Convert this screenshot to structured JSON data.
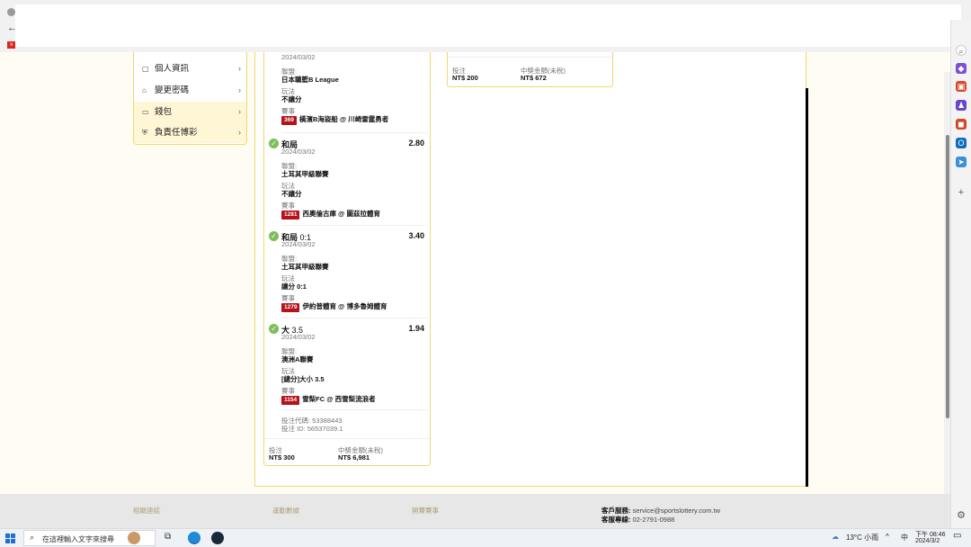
{
  "side_menu": {
    "items": [
      {
        "label": "個人資訊",
        "icon": "user-card-icon"
      },
      {
        "label": "變更密碼",
        "icon": "lock-icon"
      },
      {
        "label": "錢包",
        "icon": "wallet-icon"
      },
      {
        "label": "負責任博彩",
        "icon": "shield-icon"
      }
    ]
  },
  "ticket1": {
    "leg0": {
      "date": "2024/03/02",
      "league_label": "聯盟:",
      "league": "日本職籃B League",
      "bet_label": "玩法",
      "bet": "不讓分",
      "event_label": "賽事",
      "event_no": "369",
      "event": "橫濱B海盜船 @ 川崎雷霆勇者"
    },
    "leg1": {
      "selection": "和局",
      "odds": "2.80",
      "date": "2024/03/02",
      "league_label": "聯盟:",
      "league": "土耳其甲級聯賽",
      "bet_label": "玩法",
      "bet": "不讓分",
      "event_label": "賽事",
      "event_no": "1281",
      "event": "西奧倫古庫 @ 圖茲拉體育"
    },
    "leg2": {
      "selection": "和局",
      "selection_extra": "0:1",
      "odds": "3.40",
      "date": "2024/03/02",
      "league_label": "聯盟:",
      "league": "土耳其甲級聯賽",
      "bet_label": "玩法",
      "bet": "讓分 0:1",
      "event_label": "賽事",
      "event_no": "1279",
      "event": "伊約普體育 @ 博多魯姆體育"
    },
    "leg3": {
      "selection": "大",
      "selection_extra": "3.5",
      "odds": "1.94",
      "date": "2024/03/02",
      "league_label": "聯盟:",
      "league": "澳洲A聯賽",
      "bet_label": "玩法",
      "bet": "[總分]大小 3.5",
      "event_label": "賽事",
      "event_no": "1154",
      "event": "雪梨FC @ 西雪梨流浪者"
    },
    "code": "投注代碼: 53388443",
    "id": "投注 ID: 56537039.1",
    "stake_label": "投注",
    "stake": "NT$ 300",
    "win_label": "中獎金額(未稅)",
    "win": "NT$ 6,981"
  },
  "ticket2": {
    "stake_label": "投注",
    "stake": "NT$ 200",
    "win_label": "中獎金額(未稅)",
    "win": "NT$ 672"
  },
  "footer": {
    "col1": "相關連結",
    "col2": "運動數據",
    "col3": "開賽賽事",
    "service_label": "客戶服務:",
    "service_email": "service@sportslottery.com.tw",
    "hotline_label": "客服專線:",
    "hotline": "02-2791-0988"
  },
  "taskbar": {
    "search_placeholder": "在這裡輸入文字來搜尋",
    "weather": "13°C 小雨",
    "ime": "中",
    "time": "下午 08:46",
    "date": "2024/3/2"
  },
  "colors": {
    "accent_border": "#f0d870",
    "event_badge": "#b5121b",
    "check": "#7cbf5a"
  }
}
